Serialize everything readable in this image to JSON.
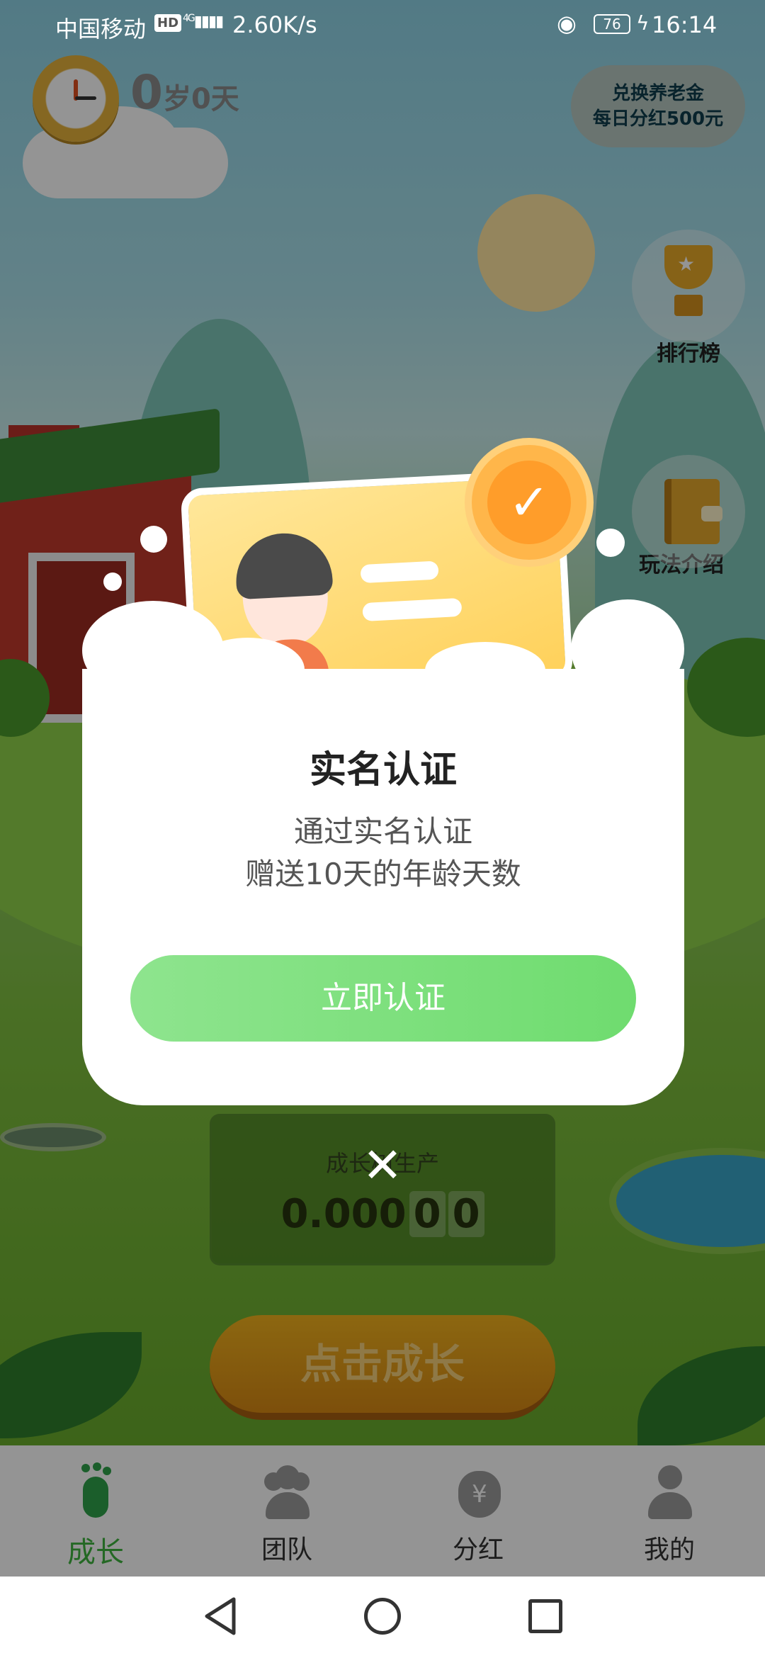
{
  "status_bar": {
    "carrier": "中国移动",
    "hd": "HD",
    "network": "4G",
    "speed": "2.60K/s",
    "battery": "76",
    "time": "16:14"
  },
  "hud": {
    "age_years": "0",
    "age_years_unit": "岁",
    "age_days": "0",
    "age_days_unit": "天",
    "exchange_line1": "兑换养老金",
    "exchange_line2": "每日分红500元",
    "ranking_label": "排行榜",
    "guide_label": "玩法介绍"
  },
  "production": {
    "label": "成长树生产",
    "value_main": "0.000",
    "value_cell1": "0",
    "value_cell2": "0"
  },
  "grow_button": "点击成长",
  "modal": {
    "title": "实名认证",
    "line1": "通过实名认证",
    "line2": "赠送10天的年龄天数",
    "button": "立即认证",
    "close_symbol": "✕"
  },
  "tabs": [
    {
      "label": "成长",
      "icon": "footprint-icon",
      "active": true
    },
    {
      "label": "团队",
      "icon": "team-icon",
      "active": false
    },
    {
      "label": "分红",
      "icon": "money-bag-icon",
      "active": false
    },
    {
      "label": "我的",
      "icon": "profile-icon",
      "active": false
    }
  ],
  "colors": {
    "accent_green": "#3fb43f",
    "button_green": "#6fdc6f",
    "grow_orange": "#f2b21d",
    "badge_orange": "#ff9d2a"
  }
}
